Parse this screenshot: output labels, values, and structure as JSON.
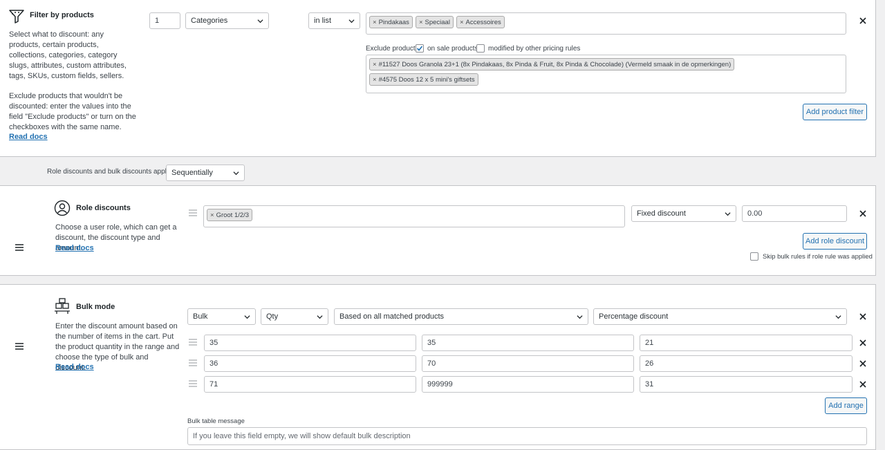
{
  "filter": {
    "title": "Filter by products",
    "desc1": "Select what to discount: any products, certain products, collections, categories, category slugs, attributes, custom attributes, tags, SKUs, custom fields, sellers.",
    "desc2": "Exclude products that wouldn't be discounted: enter the values into the field \"Exclude products\" or turn on the checkboxes with the same name.",
    "read_docs": "Read docs",
    "qty": "1",
    "type": "Categories",
    "operator": "in list",
    "tags": [
      "Pindakaas",
      "Speciaal",
      "Accessoires"
    ],
    "exclude_label": "Exclude products",
    "on_sale_label": "on sale products",
    "modified_label": "modified by other pricing rules",
    "exclude_items": [
      "#11527 Doos Granola 23+1 (8x Pindakaas, 8x Pinda & Fruit, 8x Pinda & Chocolade) (Vermeld smaak in de opmerkingen)",
      "#4575 Doos 12 x 5 mini's giftsets"
    ],
    "add_button": "Add product filter"
  },
  "applied": {
    "label": "Role discounts and bulk discounts applied",
    "value": "Sequentially"
  },
  "role": {
    "title": "Role discounts",
    "desc": "Choose a user role, which can get a discount, the discount type and amount.",
    "read_docs": "Read docs",
    "tag": "Groot 1/2/3",
    "discount_type": "Fixed discount",
    "amount": "0.00",
    "add_button": "Add role discount",
    "skip_label": "Skip bulk rules if role rule was applied"
  },
  "bulk": {
    "title": "Bulk mode",
    "desc": "Enter the discount amount based on the number of items in the cart. Put the product quantity in the range and choose the type of bulk and discount.",
    "read_docs": "Read docs",
    "mode": "Bulk",
    "measure": "Qty",
    "based_on": "Based on all matched products",
    "discount_type": "Percentage discount",
    "ranges": [
      {
        "from": "35",
        "to": "35",
        "value": "21"
      },
      {
        "from": "36",
        "to": "70",
        "value": "26"
      },
      {
        "from": "71",
        "to": "999999",
        "value": "31"
      }
    ],
    "add_range": "Add range",
    "message_label": "Bulk table message",
    "message_placeholder": "If you leave this field empty, we will show default bulk description"
  },
  "colors": {
    "accent": "#2271b1",
    "border": "#c3c4c7",
    "bg": "#f0f0f1"
  }
}
